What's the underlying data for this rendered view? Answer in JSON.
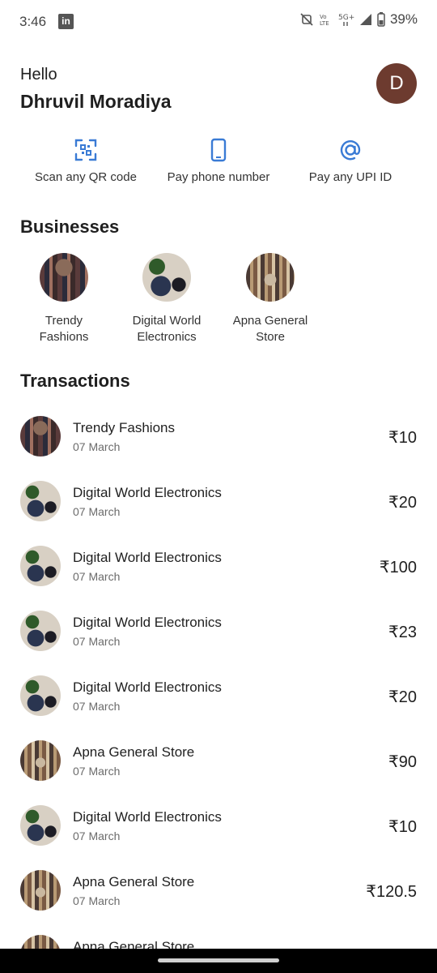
{
  "status_bar": {
    "time": "3:46",
    "notification_app": "in",
    "battery": "39%",
    "icons": [
      "mute-icon",
      "volte-icon",
      "5g-icon",
      "signal-icon",
      "battery-icon"
    ]
  },
  "header": {
    "greeting": "Hello",
    "user_name": "Dhruvil Moradiya",
    "avatar_initial": "D",
    "avatar_color": "#6d3b2f"
  },
  "actions": [
    {
      "label": "Scan any QR code",
      "icon": "qr-scan-icon"
    },
    {
      "label": "Pay phone number",
      "icon": "phone-icon"
    },
    {
      "label": "Pay any UPI ID",
      "icon": "at-icon"
    }
  ],
  "accent_color": "#3a7bd5",
  "businesses": {
    "title": "Businesses",
    "items": [
      {
        "line1": "Trendy",
        "line2": "Fashions",
        "image": "fashion"
      },
      {
        "line1": "Digital World",
        "line2": "Electronics",
        "image": "electronics"
      },
      {
        "line1": "Apna General",
        "line2": "Store",
        "image": "store"
      }
    ]
  },
  "transactions": {
    "title": "Transactions",
    "items": [
      {
        "name": "Trendy Fashions",
        "date": "07 March",
        "amount": "₹10",
        "image": "fashion"
      },
      {
        "name": "Digital World Electronics",
        "date": "07 March",
        "amount": "₹20",
        "image": "electronics"
      },
      {
        "name": "Digital World Electronics",
        "date": "07 March",
        "amount": "₹100",
        "image": "electronics"
      },
      {
        "name": "Digital World Electronics",
        "date": "07 March",
        "amount": "₹23",
        "image": "electronics"
      },
      {
        "name": "Digital World Electronics",
        "date": "07 March",
        "amount": "₹20",
        "image": "electronics"
      },
      {
        "name": "Apna General Store",
        "date": "07 March",
        "amount": "₹90",
        "image": "store"
      },
      {
        "name": "Digital World Electronics",
        "date": "07 March",
        "amount": "₹10",
        "image": "electronics"
      },
      {
        "name": "Apna General Store",
        "date": "07 March",
        "amount": "₹120.5",
        "image": "store"
      },
      {
        "name": "Apna General Store",
        "date": "",
        "amount": "",
        "image": "store"
      }
    ]
  }
}
